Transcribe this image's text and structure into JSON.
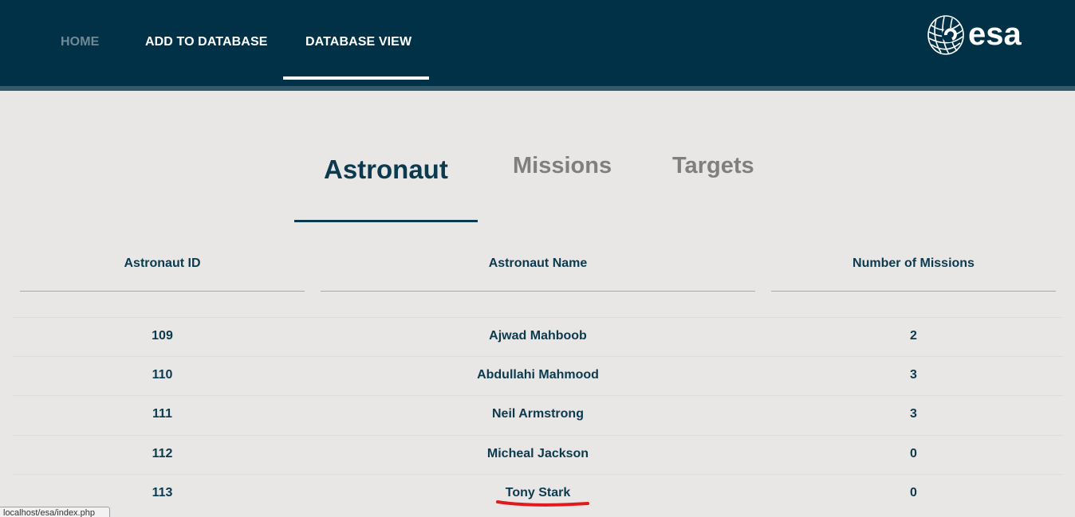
{
  "nav": {
    "items": [
      {
        "label": "HOME",
        "state": "muted"
      },
      {
        "label": "ADD TO DATABASE",
        "state": "normal"
      },
      {
        "label": "DATABASE VIEW",
        "state": "active"
      }
    ],
    "logo_text": "esa",
    "logo_icon": "esa-logo-icon"
  },
  "tabs": [
    {
      "label": "Astronaut",
      "active": true
    },
    {
      "label": "Missions",
      "active": false
    },
    {
      "label": "Targets",
      "active": false
    }
  ],
  "table": {
    "headers": [
      "Astronaut ID",
      "Astronaut Name",
      "Number of Missions"
    ],
    "rows": [
      {
        "id": "109",
        "name": "Ajwad Mahboob",
        "missions": "2"
      },
      {
        "id": "110",
        "name": "Abdullahi Mahmood",
        "missions": "3"
      },
      {
        "id": "111",
        "name": "Neil Armstrong",
        "missions": "3"
      },
      {
        "id": "112",
        "name": "Micheal Jackson",
        "missions": "0"
      },
      {
        "id": "113",
        "name": "Tony Stark",
        "missions": "0"
      }
    ]
  },
  "status_bar": {
    "url": "localhost/esa/index.php"
  },
  "colors": {
    "header_bg": "#003147",
    "accent": "#0b3a4e",
    "page_bg": "#e9e7e5",
    "annotation": "#e11b1b"
  }
}
